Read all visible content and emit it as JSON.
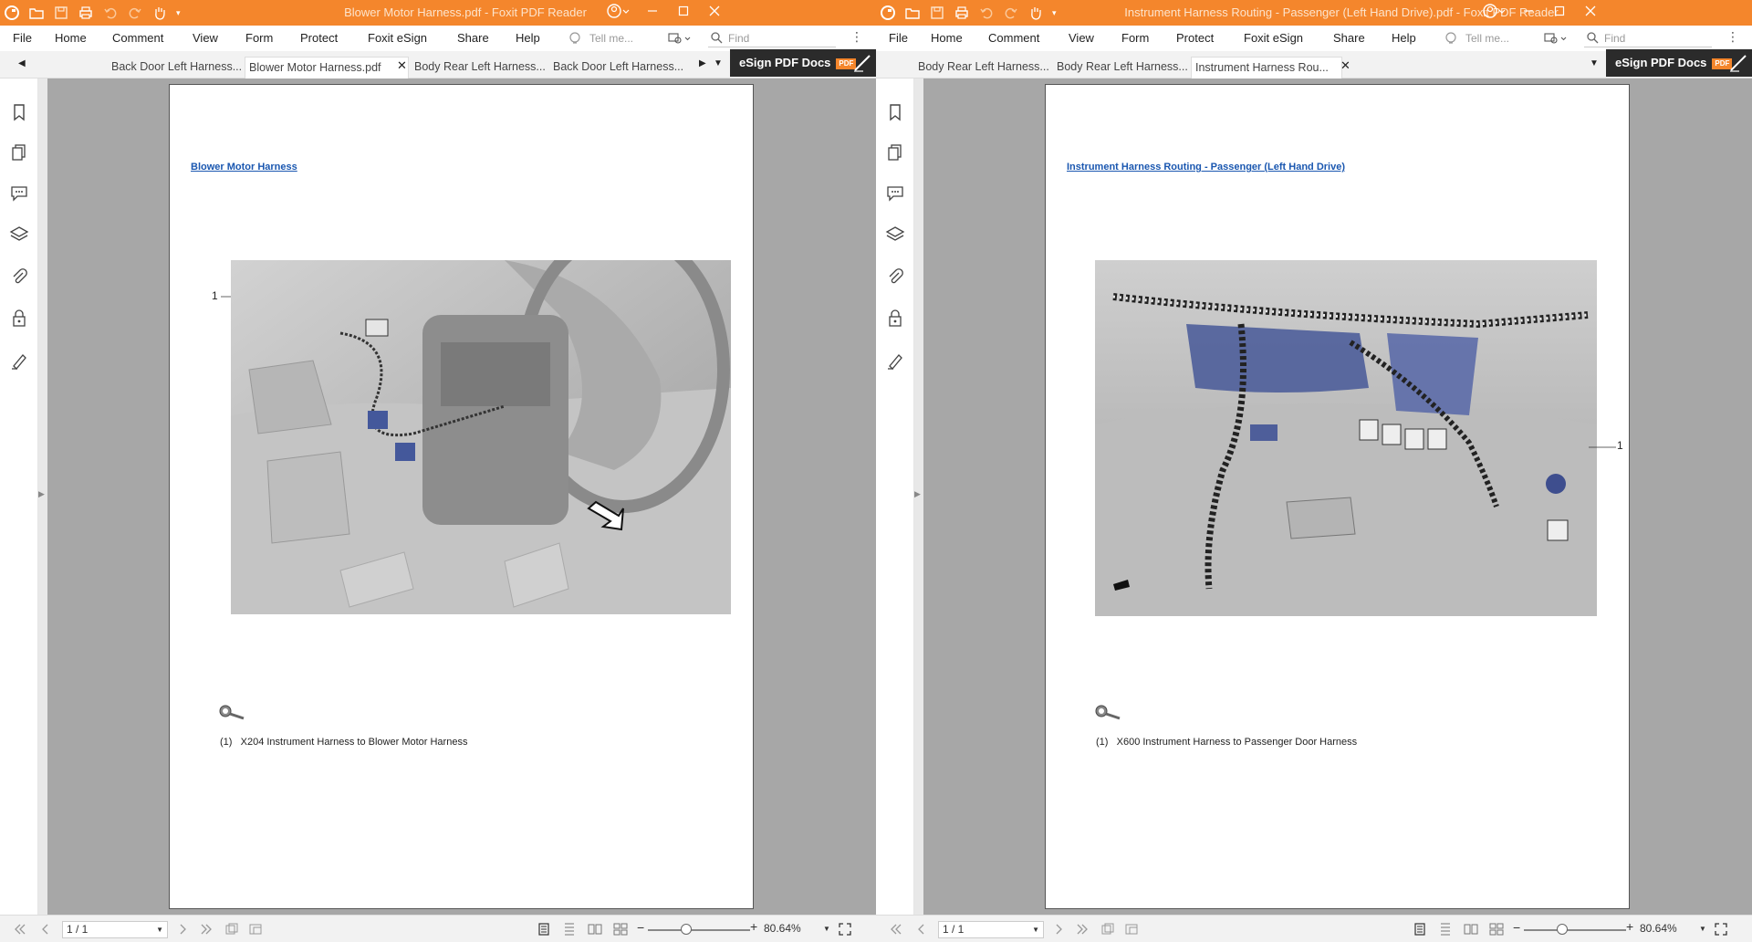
{
  "windows": [
    {
      "title": "Blower Motor Harness.pdf - Foxit PDF Reader",
      "menu": [
        "File",
        "Home",
        "Comment",
        "View",
        "Form",
        "Protect",
        "Foxit eSign",
        "Share",
        "Help"
      ],
      "tell_me_placeholder": "Tell me...",
      "find_placeholder": "Find",
      "tabs": [
        {
          "label": "Back Door Left Harness...",
          "active": false
        },
        {
          "label": "Blower Motor Harness.pdf",
          "active": true
        },
        {
          "label": "Body Rear Left Harness...",
          "active": false
        },
        {
          "label": "Back Door Left Harness...",
          "active": false
        }
      ],
      "esign_label": "eSign PDF Docs",
      "pdf_badge": "PDF",
      "document": {
        "title": "Blower Motor Harness",
        "callout": "1",
        "caption_index": "(1)",
        "caption_text": "X204 Instrument Harness to Blower Motor Harness"
      },
      "status": {
        "page": "1 / 1",
        "zoom": "80.64%",
        "zoom_level_percent": 80.64
      }
    },
    {
      "title": "Instrument Harness Routing - Passenger (Left Hand Drive).pdf - Foxit PDF Reader",
      "menu": [
        "File",
        "Home",
        "Comment",
        "View",
        "Form",
        "Protect",
        "Foxit eSign",
        "Share",
        "Help"
      ],
      "tell_me_placeholder": "Tell me...",
      "find_placeholder": "Find",
      "tabs": [
        {
          "label": "Body Rear Left Harness...",
          "active": false
        },
        {
          "label": "Body Rear Left Harness...",
          "active": false
        },
        {
          "label": "Instrument Harness Rou...",
          "active": true
        }
      ],
      "esign_label": "eSign PDF Docs",
      "pdf_badge": "PDF",
      "document": {
        "title": "Instrument Harness Routing - Passenger (Left Hand Drive)",
        "callout": "1",
        "caption_index": "(1)",
        "caption_text": "X600 Instrument Harness to Passenger Door Harness"
      },
      "status": {
        "page": "1 / 1",
        "zoom": "80.64%",
        "zoom_level_percent": 80.64
      }
    }
  ],
  "colors": {
    "titlebar": "#f4862c",
    "link": "#1a57b0",
    "canvas": "#a7a7a7",
    "esign_bg": "#2b2b2b"
  }
}
